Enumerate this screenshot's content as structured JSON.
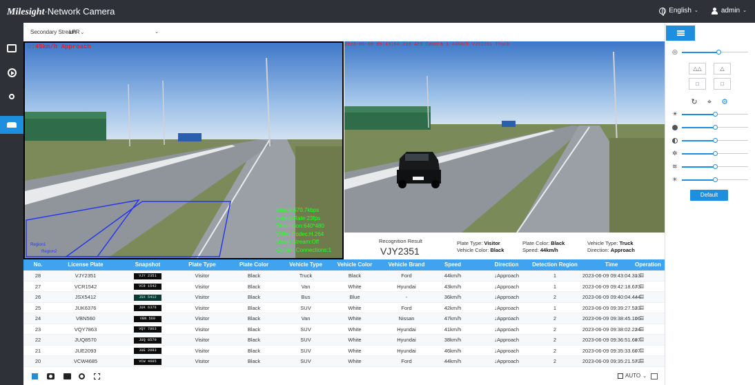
{
  "header": {
    "brand_logo": "Milesight",
    "brand_product": "·Network Camera",
    "language": "English",
    "user": "admin"
  },
  "nav": {
    "items": [
      {
        "icon": "live-view-icon",
        "active": false
      },
      {
        "icon": "playback-icon",
        "active": false
      },
      {
        "icon": "settings-icon",
        "active": false
      },
      {
        "icon": "vehicle-icon",
        "active": true
      }
    ]
  },
  "toolbar": {
    "stream_select": "Secondary Stream",
    "mode_select": "LPR"
  },
  "live": {
    "speed_overlay": "○:45km/h Approach",
    "info_lines": [
      "Bitrate:570.7kbps",
      "Frame Rate:23fps",
      "Resolution:640*480",
      "Video Codec:H.264",
      "Smart Stream:Off",
      "Current Connections:1"
    ],
    "region1": "Region1",
    "region2": "Region2"
  },
  "snapshot": {
    "overlay": "2023-06-09 09:43:04.313 AES Camera 1 44km/h VJY2351 Truck",
    "truck_plate": "VJY2351"
  },
  "recognition": {
    "label": "Recognition Result",
    "plate": "VJY2351",
    "plate_type_label": "Plate Type:",
    "plate_type": "Visitor",
    "vehicle_color_label": "Vehicle Color:",
    "vehicle_color": "Black",
    "plate_color_label": "Plate Color:",
    "plate_color": "Black",
    "speed_label": "Speed:",
    "speed": "44km/h",
    "vehicle_type_label": "Vehicle Type:",
    "vehicle_type": "Truck",
    "direction_label": "Direction:",
    "direction": "Approach"
  },
  "table": {
    "headers": [
      "No.",
      "License Plate",
      "Snapshot",
      "Plate Type",
      "Plate Color",
      "Vehicle Type",
      "Vehicle Color",
      "Vehicle Brand",
      "Speed",
      "Direction",
      "Detection Region",
      "Time",
      "Operation"
    ],
    "rows": [
      {
        "no": "28",
        "plate": "VJY2351",
        "snap": "VJY 2351",
        "ptype": "Visitor",
        "pcolor": "Black",
        "vtype": "Truck",
        "vcolor": "Black",
        "brand": "Ford",
        "speed": "44km/h",
        "dir": "Approach",
        "region": "1",
        "time": "2023-06-09 09:43:04.313"
      },
      {
        "no": "27",
        "plate": "VCR1542",
        "snap": "VCR 1542",
        "ptype": "Visitor",
        "pcolor": "Black",
        "vtype": "Van",
        "vcolor": "White",
        "brand": "Hyundai",
        "speed": "43km/h",
        "dir": "Approach",
        "region": "1",
        "time": "2023-06-09 09:42:18.673"
      },
      {
        "no": "26",
        "plate": "JSX5412",
        "snap": "JSX 5412",
        "ptype": "Visitor",
        "pcolor": "Black",
        "vtype": "Bus",
        "vcolor": "Blue",
        "brand": "-",
        "speed": "36km/h",
        "dir": "Approach",
        "region": "2",
        "time": "2023-06-09 09:40:04.444"
      },
      {
        "no": "25",
        "plate": "JUK6376",
        "snap": "JUK 6376",
        "ptype": "Visitor",
        "pcolor": "Black",
        "vtype": "SUV",
        "vcolor": "White",
        "brand": "Ford",
        "speed": "42km/h",
        "dir": "Approach",
        "region": "1",
        "time": "2023-06-09 09:39:27.523"
      },
      {
        "no": "24",
        "plate": "VBN560",
        "snap": "VBN 560",
        "ptype": "Visitor",
        "pcolor": "Black",
        "vtype": "Van",
        "vcolor": "White",
        "brand": "Nissan",
        "speed": "47km/h",
        "dir": "Approach",
        "region": "2",
        "time": "2023-06-09 09:38:45.106"
      },
      {
        "no": "23",
        "plate": "VQY7863",
        "snap": "VQY 7863",
        "ptype": "Visitor",
        "pcolor": "Black",
        "vtype": "SUV",
        "vcolor": "White",
        "brand": "Hyundai",
        "speed": "41km/h",
        "dir": "Approach",
        "region": "2",
        "time": "2023-06-09 09:38:02.224"
      },
      {
        "no": "22",
        "plate": "JUQ8570",
        "snap": "JUQ 8570",
        "ptype": "Visitor",
        "pcolor": "Black",
        "vtype": "SUV",
        "vcolor": "White",
        "brand": "Hyundai",
        "speed": "38km/h",
        "dir": "Approach",
        "region": "2",
        "time": "2023-06-09 09:36:51.687"
      },
      {
        "no": "21",
        "plate": "JUE2093",
        "snap": "JUE 2093",
        "ptype": "Visitor",
        "pcolor": "Black",
        "vtype": "SUV",
        "vcolor": "White",
        "brand": "Hyundai",
        "speed": "46km/h",
        "dir": "Approach",
        "region": "2",
        "time": "2023-06-09 09:35:33.607"
      },
      {
        "no": "20",
        "plate": "VCW4685",
        "snap": "VCW 4685",
        "ptype": "Visitor",
        "pcolor": "Black",
        "vtype": "SUV",
        "vcolor": "White",
        "brand": "Ford",
        "speed": "44km/h",
        "dir": "Approach",
        "region": "2",
        "time": "2023-06-09 09:35:21.572"
      }
    ]
  },
  "bottom": {
    "auto_label": "AUTO"
  },
  "right_panel": {
    "default_button": "Default",
    "sliders": [
      {
        "icon": "zoom-icon",
        "level": 0.55
      },
      {
        "icon": "brightness-icon",
        "level": 0.5
      },
      {
        "icon": "contrast-icon",
        "level": 0.5
      },
      {
        "icon": "saturation-icon",
        "level": 0.5
      },
      {
        "icon": "sharpness-icon",
        "level": 0.5
      },
      {
        "icon": "noise-reduction-icon",
        "level": 0.5
      },
      {
        "icon": "denoise-icon",
        "level": 0.5
      }
    ]
  },
  "colors": {
    "accent": "#1e8fde",
    "table_header": "#3fa3ef",
    "topbar": "#2e3238",
    "overlay_green": "#2bff2b",
    "overlay_red": "#e1212a"
  }
}
